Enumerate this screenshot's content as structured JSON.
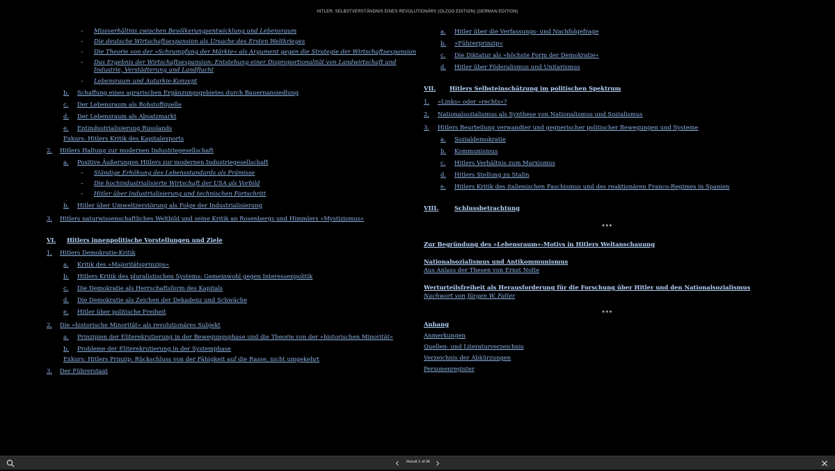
{
  "header": {
    "title": "HITLER. SELBSTVERSTÄNDNIS EINES REVOLUTIONÄRS (OLZOG EDITION) (GERMAN EDITION)"
  },
  "toc_left": [
    {
      "m": "–",
      "t": "Missverhältnis zwischen Bevölkerungsentwicklung und Lebensraum",
      "i": true
    },
    {
      "m": "–",
      "t": "Die deutsche Wirtschaftsexpansion als Ursache des Ersten Weltkrieges",
      "i": true
    },
    {
      "m": "–",
      "t": "Die Theorie von der »Schrumpfung der Märkte« als Argument gegen die Strategie der Wirtschaftsexpansion",
      "i": true
    },
    {
      "m": "–",
      "t": "Das Ergebnis der Wirtschaftsexpansion: Entstehung einer Disproportionalität von Landwirtschaft und Industrie, Verstädterung und Landflucht",
      "i": true
    },
    {
      "m": "–",
      "t": "Lebensraum und Autarkie-Konzept",
      "i": true
    },
    {
      "m": "b.",
      "t": "Schaffung eines agrarischen Ergänzungsgebietes durch Bauernansiedlung"
    },
    {
      "m": "c.",
      "t": "Der Lebensraum als Rohstoffquelle"
    },
    {
      "m": "d.",
      "t": "Der Lebensraum als Absatzmarkt"
    },
    {
      "m": "e.",
      "t": "Entindustrialisierung Russlands"
    },
    {
      "m": "",
      "t": "Exkurs: Hitlers Kritik des Kapitalexports"
    },
    {
      "m": "2.",
      "t": "Hitlers Haltung zur modernen Industriegesellschaft"
    },
    {
      "m": "a.",
      "t": "Positive Äußerungen Hitlers zur modernen Industriegesellschaft"
    },
    {
      "m": "–",
      "t": "Ständige Erhöhung des Lebensstandards als Prämisse",
      "i": true
    },
    {
      "m": "–",
      "t": "Die hochindustrialisierte Wirtschaft der USA als Vorbild",
      "i": true
    },
    {
      "m": "–",
      "t": "Hitler über Industrialisierung und technischen Fortschritt",
      "i": true
    },
    {
      "m": "b.",
      "t": "Hitler über Umweltzerstörung als Folge der Industrialisierung"
    },
    {
      "m": "3.",
      "t": "Hitlers naturwissenschaftliches Weltbild und seine Kritik an Rosenbergs und Himmlers »Mystizismus«"
    },
    {
      "m": "VI.",
      "t": "Hitlers innenpolitische Vorstellungen und Ziele",
      "b": true
    },
    {
      "m": "1.",
      "t": "Hitlers Demokratie-Kritik"
    },
    {
      "m": "a.",
      "t": "Kritik des »Majoritätsprinzips«"
    },
    {
      "m": "b.",
      "t": "Hitlers Kritik des pluralistischen Systems: Gemeinwohl gegen Interessenpolitik"
    },
    {
      "m": "c.",
      "t": "Die Demokratie als Herrschaftsform des Kapitals"
    },
    {
      "m": "d.",
      "t": "Die Demokratie als Zeichen der Dekadenz und Schwäche"
    },
    {
      "m": "e.",
      "t": "Hitler über politische Freiheit"
    },
    {
      "m": "2.",
      "t": "Die »historische Minorität« als revolutionäres Subjekt"
    },
    {
      "m": "a.",
      "t": "Prinzipien der Eliterekrutierung in der Bewegungsphase und die Theorie von der »historischen Minorität«"
    },
    {
      "m": "b.",
      "t": "Probleme der Eliterekrutierung in der Systemphase"
    },
    {
      "m": "",
      "t": "Exkurs: Hitlers Prinzip: Rückschluss von der Fähigkeit auf die Rasse, nicht umgekehrt"
    },
    {
      "m": "3.",
      "t": "Der Führerstaat"
    }
  ],
  "toc_right": [
    {
      "m": "a.",
      "t": "Hitler über die Verfassungs- und Nachfolgefrage"
    },
    {
      "m": "b.",
      "t": "»Führerprinzip«"
    },
    {
      "m": "c.",
      "t": "Die Diktatur als »höchste Form der Demokratie«"
    },
    {
      "m": "d.",
      "t": "Hitler über Föderalismus und Unitarismus"
    },
    {
      "m": "VII.",
      "t": "Hitlers Selbsteinschätzung im politischen Spektrum",
      "b": true
    },
    {
      "m": "1.",
      "t": "»Links« oder »rechts«?"
    },
    {
      "m": "2.",
      "t": "Nationalsozialismus als Synthese von Nationalismus und Sozialismus"
    },
    {
      "m": "3.",
      "t": "Hitlers Beurteilung verwandter und gegnerischer politischer Bewegungen und Systeme"
    },
    {
      "m": "a.",
      "t": "Sozialdemokratie"
    },
    {
      "m": "b.",
      "t": "Kommunismus"
    },
    {
      "m": "c.",
      "t": "Hitlers Verhältnis zum Marxismus"
    },
    {
      "m": "d.",
      "t": "Hitlers Stellung zu Stalin"
    },
    {
      "m": "e.",
      "t": "Hitlers Kritik des italienischen Faschismus und des reaktionären Franco-Regimes in Spanien"
    },
    {
      "m": "VIII.",
      "t": "Schlussbetrachtung",
      "b": true
    },
    {
      "m": "",
      "t": "Zur Begründung des »Lebensraum«-Motivs in Hitlers Weltanschauung",
      "b": true
    },
    {
      "m": "",
      "t": "Nationalsozialismus und Antikommunismus",
      "b": true
    },
    {
      "m": "",
      "t": "Aus Anlass der Thesen von Ernst Nolte"
    },
    {
      "m": "",
      "t": "Werturteilsfreiheit als Herausforderung für die Forschung über Hitler und den Nationalsozialismus",
      "b": true
    },
    {
      "m": "",
      "t": "Nachwort von Jürgen W. Falter",
      "i": true
    },
    {
      "m": "",
      "t": "Anhang",
      "b": true
    },
    {
      "m": "",
      "t": "Anmerkungen"
    },
    {
      "m": "",
      "t": "Quellen- und Literaturverzeichnis"
    },
    {
      "m": "",
      "t": "Verzeichnis der Abkürzungen"
    },
    {
      "m": "",
      "t": "Personenregister"
    }
  ],
  "separators": [
    "•••",
    "•••"
  ],
  "bottombar": {
    "result_text": "Result 1 of 96",
    "icons": [
      "search-icon",
      "chevron-left-icon",
      "chevron-right-icon",
      "close-icon"
    ]
  }
}
